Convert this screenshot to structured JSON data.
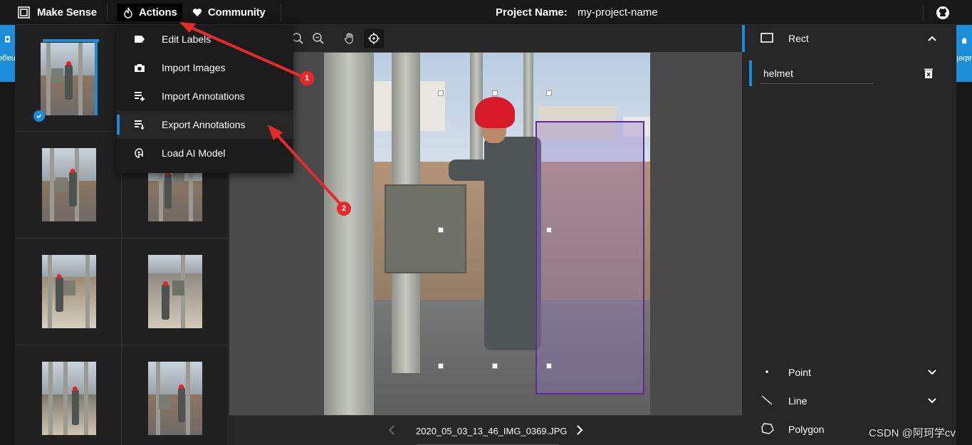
{
  "topbar": {
    "brand": "Make Sense",
    "actions_label": "Actions",
    "community_label": "Community",
    "project_label": "Project Name:",
    "project_name": "my-project-name"
  },
  "side_tabs": {
    "left": "Images",
    "right": "Labels"
  },
  "actions_menu": {
    "items": [
      {
        "label": "Edit Labels",
        "icon": "label-tag-icon"
      },
      {
        "label": "Import Images",
        "icon": "camera-icon"
      },
      {
        "label": "Import Annotations",
        "icon": "import-annotations-icon"
      },
      {
        "label": "Export Annotations",
        "icon": "export-annotations-icon"
      },
      {
        "label": "Load AI Model",
        "icon": "ai-brain-icon"
      }
    ]
  },
  "editor": {
    "filename": "2020_05_03_13_46_IMG_0369.JPG"
  },
  "labels_panel": {
    "rect_title": "Rect",
    "labels": [
      {
        "name": "helmet"
      }
    ],
    "tools": [
      {
        "label": "Point",
        "icon": "point-icon"
      },
      {
        "label": "Line",
        "icon": "line-icon"
      },
      {
        "label": "Polygon",
        "icon": "polygon-icon"
      }
    ]
  },
  "annotations": {
    "badge1": "1",
    "badge2": "2"
  },
  "watermark": "CSDN @阿珂学cv",
  "colors": {
    "accent": "#1a8cd8",
    "bbox": "#5f2a94",
    "arrow": "#e62a2a"
  }
}
